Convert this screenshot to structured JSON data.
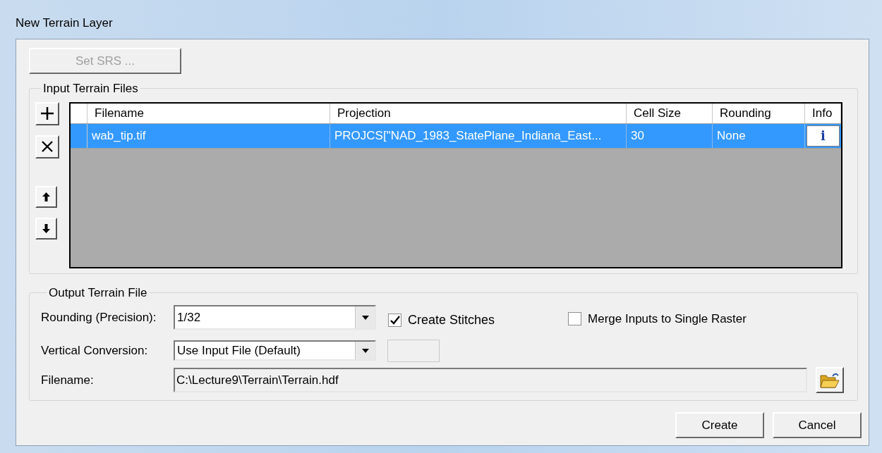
{
  "window": {
    "title": "New Terrain Layer"
  },
  "set_srs_button": {
    "label": "Set SRS ...",
    "disabled": true
  },
  "input_group": {
    "title": "Input Terrain Files",
    "table": {
      "columns": [
        "Filename",
        "Projection",
        "Cell Size",
        "Rounding",
        "Info"
      ],
      "rows": [
        {
          "selected": true,
          "cells": [
            "wab_tip.tif",
            "PROJCS[\"NAD_1983_StatePlane_Indiana_East...",
            "30",
            "None"
          ],
          "info_button": "i"
        }
      ]
    }
  },
  "output_group": {
    "title": "Output Terrain File",
    "rounding": {
      "label": "Rounding (Precision):",
      "value": "1/32"
    },
    "create_stitches": {
      "label": "Create Stitches",
      "checked": true
    },
    "merge_inputs": {
      "label": "Merge Inputs to Single Raster",
      "checked": false
    },
    "vertical_conversion": {
      "label": "Vertical Conversion:",
      "value": "Use Input File (Default)"
    },
    "filename": {
      "label": "Filename:",
      "value": "C:\\Lecture9\\Terrain\\Terrain.hdf"
    }
  },
  "buttons": [
    "Create",
    "Cancel"
  ]
}
